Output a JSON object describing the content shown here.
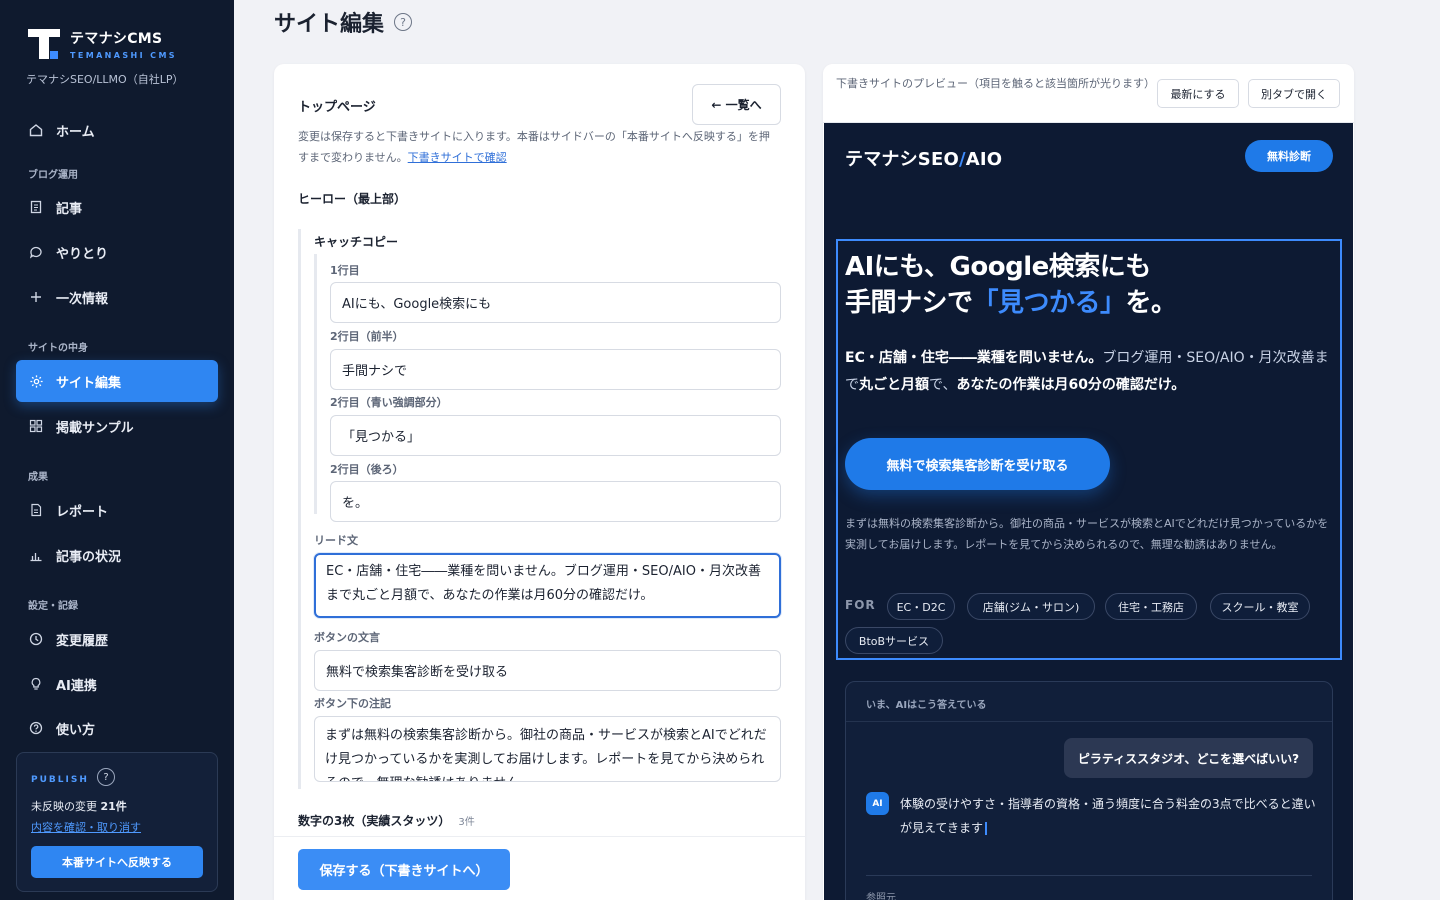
{
  "sidebar": {
    "logo_title": "テマナシCMS",
    "logo_sub": "TEMANASHI CMS",
    "site_name": "テマナシSEO/LLMO（自社LP）",
    "home": "ホーム",
    "section_blog": "ブログ運用",
    "articles": "記事",
    "conversations": "やりとり",
    "primary_info": "一次情報",
    "section_site": "サイトの中身",
    "site_edit": "サイト編集",
    "samples": "掲載サンプル",
    "section_results": "成果",
    "reports": "レポート",
    "article_status": "記事の状況",
    "section_settings": "設定・記録",
    "history": "変更履歴",
    "ai_link": "AI連携",
    "how_to": "使い方",
    "publish": {
      "label": "PUBLISH",
      "help": "?",
      "count_prefix": "未反映の変更",
      "count": "21件",
      "review_link": "内容を確認・取り消す",
      "button": "本番サイトへ反映する"
    }
  },
  "main": {
    "title": "サイト編集",
    "help": "?"
  },
  "editor": {
    "title": "トップページ",
    "back_button": "← 一覧へ",
    "desc": "変更は保存すると下書きサイトに入ります。本番はサイドバーの「本番サイトへ反映する」を押すまで変わりません。",
    "desc_link": "下書きサイトで確認",
    "hero_section": "ヒーロー（最上部）",
    "catch_group": "キャッチコピー",
    "line1_label": "1行目",
    "line1_value": "AIにも、Google検索にも",
    "line2a_label": "2行目（前半）",
    "line2a_value": "手間ナシで",
    "line2b_label": "2行目（青い強調部分）",
    "line2b_value": "「見つかる」",
    "line2c_label": "2行目（後ろ）",
    "line2c_value": "を。",
    "lead_label": "リード文",
    "lead_value": "EC・店舗・住宅――業種を問いません。ブログ運用・SEO/AIO・月次改善まで丸ごと月額で、あなたの作業は月60分の確認だけ。",
    "button_label": "ボタンの文言",
    "button_value": "無料で検索集客診断を受け取る",
    "note_label": "ボタン下の注記",
    "note_value": "まずは無料の検索集客診断から。御社の商品・サービスが検索とAIでどれだけ見つかっているかを実測してお届けします。レポートを見てから決められるので、無理な勧誘はありません。",
    "stats_section": "数字の3枚（実績スタッツ）",
    "stats_count": "3件",
    "save_button": "保存する（下書きサイトへ）"
  },
  "preview": {
    "note": "下書きサイトのプレビュー（項目を触ると該当箇所が光ります）",
    "refresh_button": "最新にする",
    "open_tab_button": "別タブで開く",
    "site": {
      "logo_a": "テマナシSEO",
      "logo_slash": "/",
      "logo_b": "AIO",
      "top_cta": "無料診断",
      "hero_line1": "AIにも、Google検索にも",
      "hero_line2_pre": "手間ナシで",
      "hero_line2_blue": "「見つかる」",
      "hero_line2_post": "を。",
      "lead_bold1": "EC・店舗・住宅――業種を問いません。",
      "lead_dim": "ブログ運用・SEO/AIO・月次改善まで",
      "lead_bold2": "丸ごと月額",
      "lead_dim2": "で、",
      "lead_bold3": "あなたの作業は月60分の確認だけ。",
      "cta": "無料で検索集客診断を受け取る",
      "note": "まずは無料の検索集客診断から。御社の商品・サービスが検索とAIでどれだけ見つかっているかを実測してお届けします。レポートを見てから決められるので、無理な勧誘はありません。",
      "for_label": "FOR",
      "tags": [
        "EC・D2C",
        "店舗(ジム・サロン)",
        "住宅・工務店",
        "スクール・教室",
        "BtoBサービス"
      ],
      "ai_card_title": "いま、AIはこう答えている",
      "ai_question": "ピラティススタジオ、どこを選べばいい?",
      "ai_badge": "AI",
      "ai_answer": "体験の受けやすさ・指導者の資格・通う頻度に合う料金の3点で比べると違いが見えてきます",
      "ai_ref": "参照元"
    }
  },
  "colors": {
    "sidebar_bg": "#0f1a2e",
    "accent": "#2f86f2",
    "preview_bg": "#0d1a33",
    "highlight": "#3d8bfd"
  }
}
